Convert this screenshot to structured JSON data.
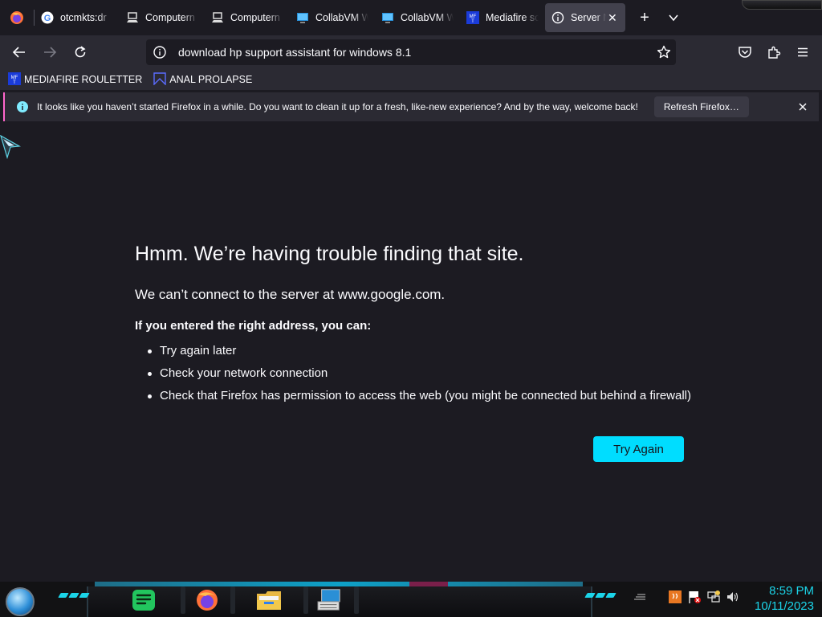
{
  "tabs": [
    {
      "title": "otcmkts:dr",
      "icon": "google-icon"
    },
    {
      "title": "Computern",
      "icon": "computer-icon"
    },
    {
      "title": "Computern",
      "icon": "computer-icon"
    },
    {
      "title": "CollabVM W",
      "icon": "monitor-icon"
    },
    {
      "title": "CollabVM W",
      "icon": "monitor-icon"
    },
    {
      "title": "Mediafire sc",
      "icon": "mediafire-icon"
    },
    {
      "title": "Server Nc",
      "icon": "info-icon",
      "active": true
    }
  ],
  "newtab_label": "+",
  "url": "download hp support assistant for windows 8.1",
  "bookmarks": [
    {
      "label": "MEDIAFIRE ROULETTER",
      "icon": "mediafire-icon"
    },
    {
      "label": "ANAL PROLAPSE",
      "icon": "bookmark-icon"
    }
  ],
  "notification": {
    "message": "It looks like you haven’t started Firefox in a while. Do you want to clean it up for a fresh, like-new experience? And by the way, welcome back!",
    "button": "Refresh Firefox…"
  },
  "error": {
    "title": "Hmm. We’re having trouble finding that site.",
    "subtitle": "We can’t connect to the server at www.google.com.",
    "lead": "If you entered the right address, you can:",
    "suggestions": [
      "Try again later",
      "Check your network connection",
      "Check that Firefox has permission to access the web (you might be connected but behind a firewall)"
    ],
    "button": "Try Again"
  },
  "clock": {
    "time": "8:59 PM",
    "date": "10/11/2023"
  },
  "colors": {
    "accent": "#00ddff",
    "background": "#1c1b22",
    "toolbar": "#2b2a33",
    "notify_border": "#ff66cc",
    "clock": "#1bd4e8"
  }
}
